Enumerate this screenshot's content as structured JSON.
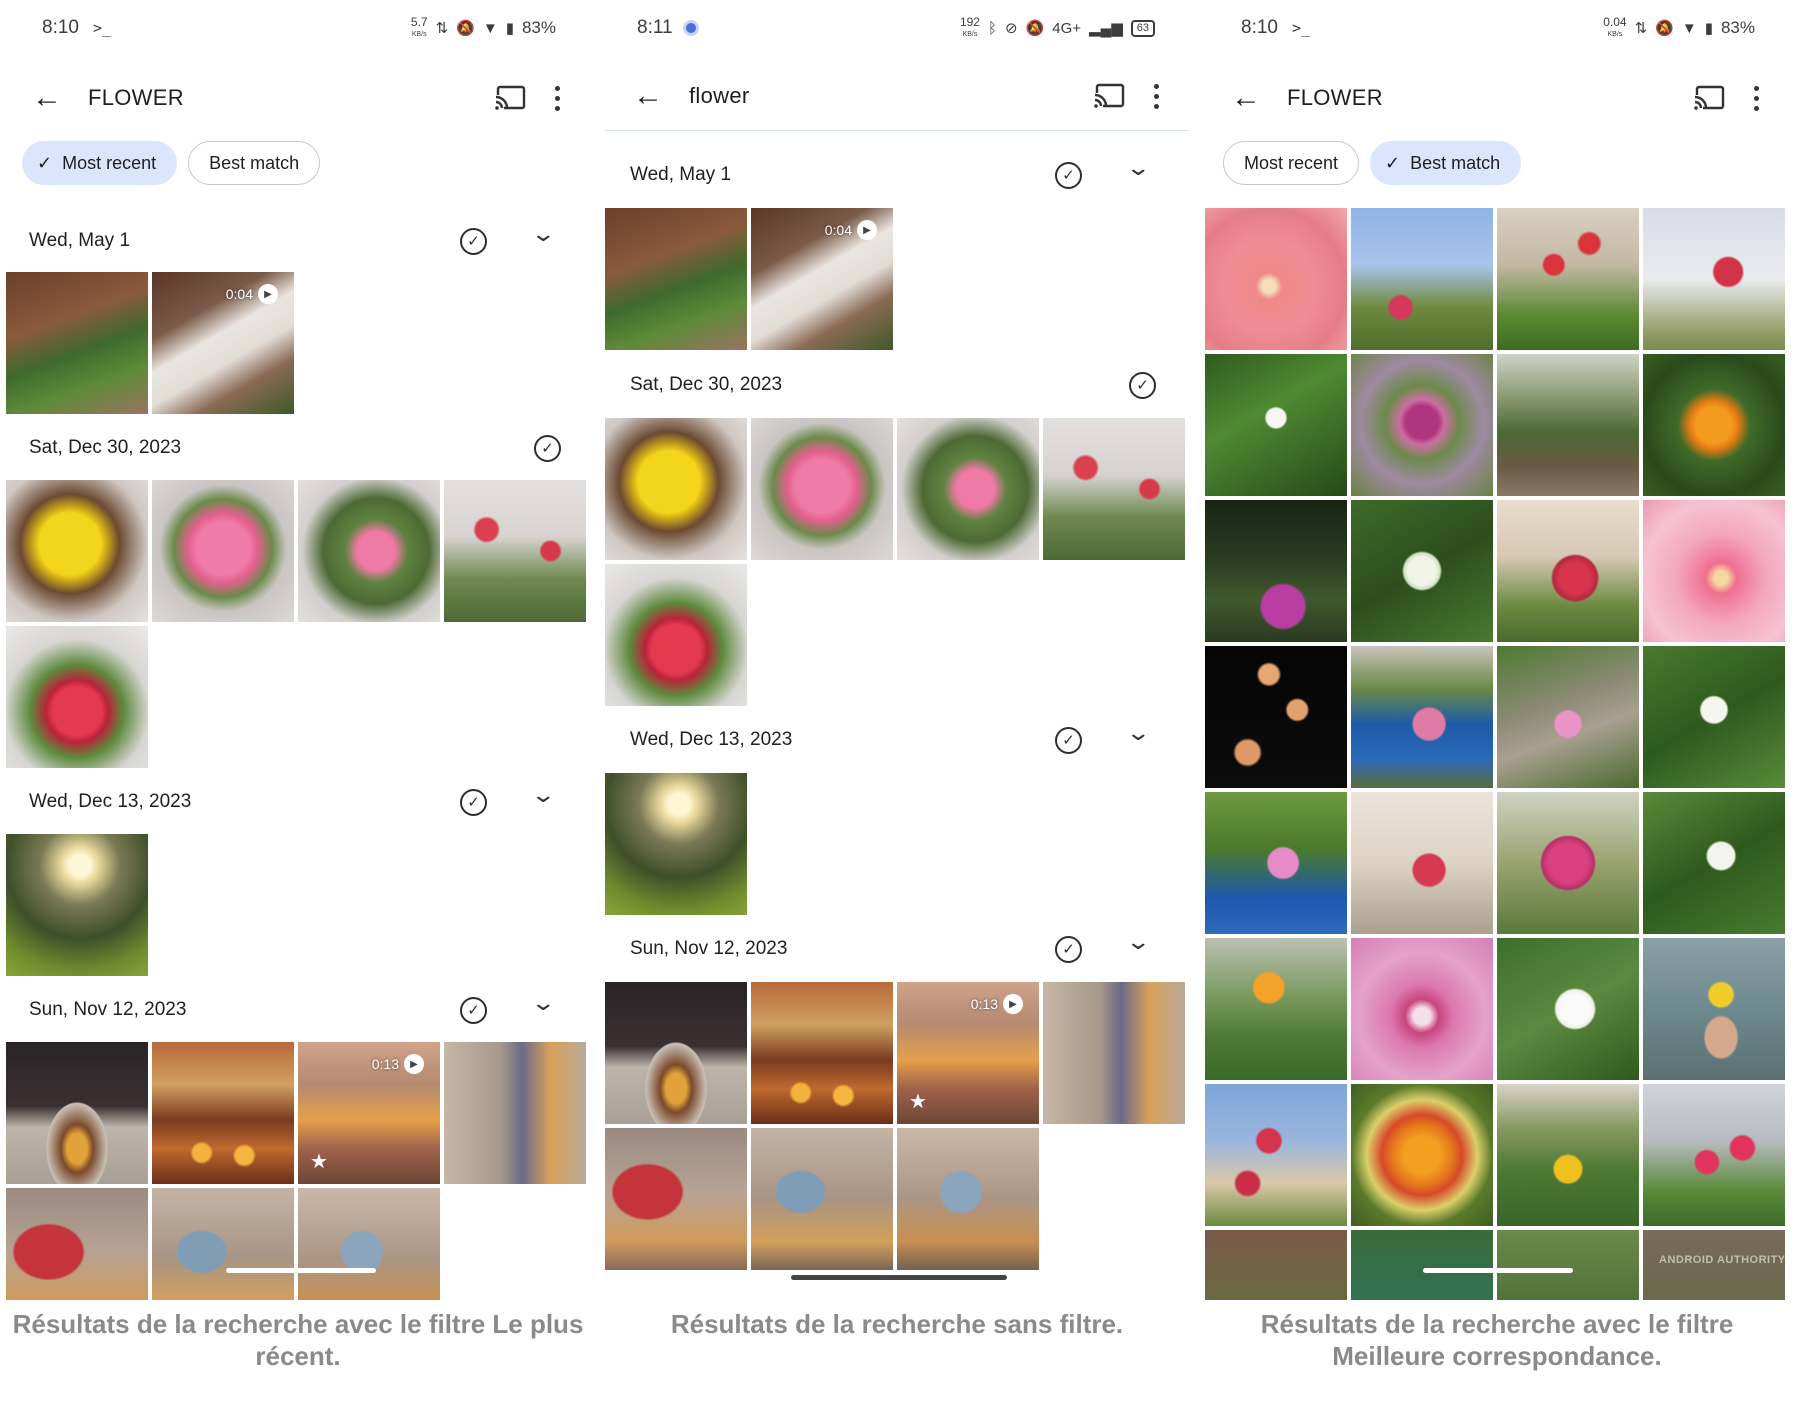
{
  "status_left": {
    "time": "8:10",
    "term_glyph": ">_",
    "speed_top": "5.7",
    "speed_unit": "KB/s",
    "battery": "83%"
  },
  "status_mid": {
    "time": "8:11",
    "speed_top": "192",
    "speed_unit": "KB/s",
    "network": "4G+",
    "battery": "63"
  },
  "status_right": {
    "time": "8:10",
    "term_glyph": ">_",
    "speed_top": "0.04",
    "speed_unit": "KB/s",
    "battery": "83%"
  },
  "app_left": {
    "back_glyph": "←",
    "title": "FLOWER"
  },
  "app_mid": {
    "back_glyph": "←",
    "title": "flower"
  },
  "app_right": {
    "back_glyph": "←",
    "title": "FLOWER"
  },
  "chips_left": {
    "most_recent": "Most recent",
    "best_match": "Best match",
    "check": "✓"
  },
  "chips_right": {
    "most_recent": "Most recent",
    "best_match": "Best match",
    "check": "✓"
  },
  "dates": {
    "may1": "Wed, May 1",
    "dec30": "Sat, Dec 30, 2023",
    "dec13": "Wed, Dec 13, 2023",
    "nov12": "Sun, Nov 12, 2023"
  },
  "glyphs": {
    "select_check": "✓",
    "chevron": "⌄",
    "star": "★",
    "play": "▶"
  },
  "videos": {
    "may1_duration": "0:04",
    "nov12_duration": "0:13"
  },
  "watermark": "ANDROID AUTHORITY",
  "captions": {
    "left": "Résultats de la recherche avec le filtre Le plus récent.",
    "mid": "Résultats de la recherche sans filtre.",
    "right": "Résultats de la recherche avec le filtre Meilleure correspondance."
  },
  "colors": {
    "chip_selected_bg": "#dbe5fb",
    "caption_text": "#8a8a8a",
    "search_divider": "#d7e3f5"
  },
  "icons": {
    "back": "arrow-left-icon",
    "cast": "cast-icon",
    "more": "more-vert-icon",
    "select": "check-circle-icon",
    "expand": "chevron-down-icon",
    "video": "play-icon",
    "favorite": "star-icon"
  }
}
